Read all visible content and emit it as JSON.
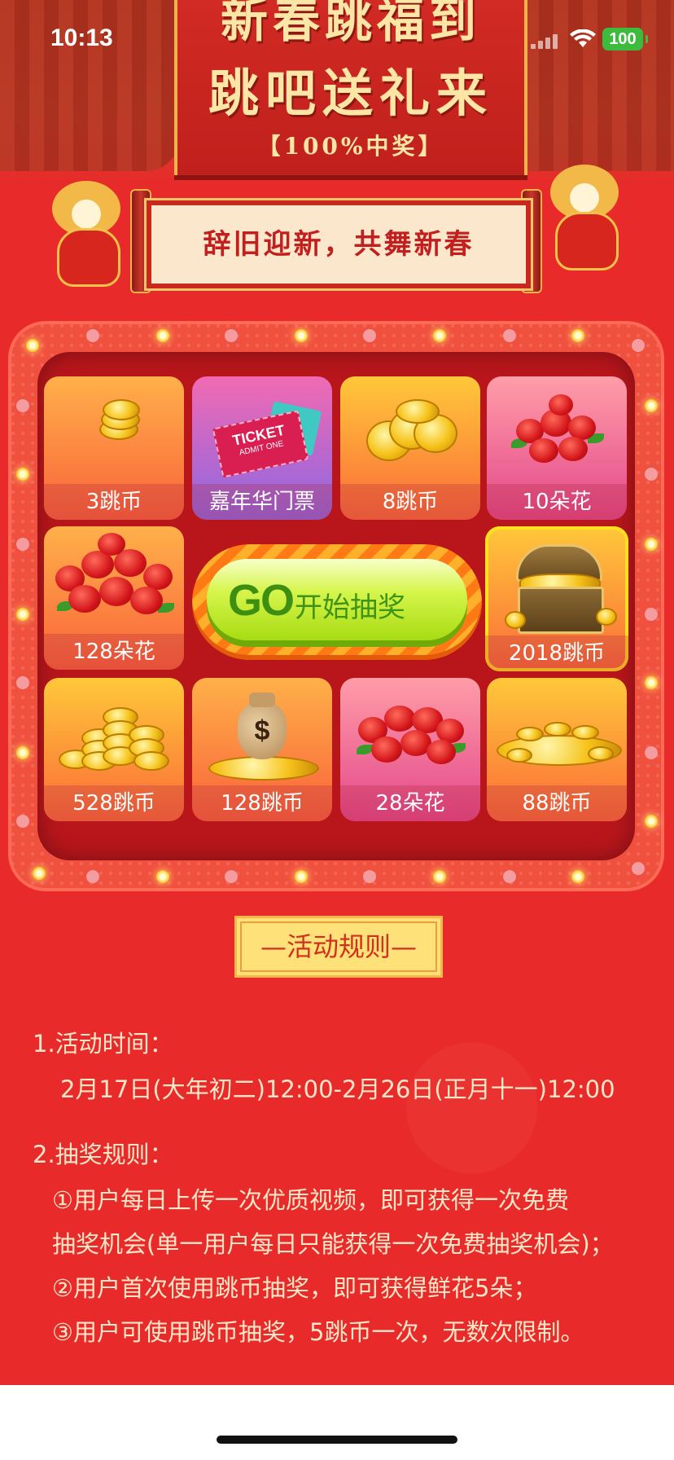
{
  "status_bar": {
    "time": "10:13",
    "battery": "100"
  },
  "header": {
    "title_line1": "新春跳福到",
    "title_line2": "跳吧送礼来",
    "subtitle": "【100%中奖】"
  },
  "slogan": "辞旧迎新，共舞新春",
  "prizes": [
    {
      "label": "3跳币",
      "icon": "coins-icon"
    },
    {
      "label": "嘉年华门票",
      "icon": "ticket-icon",
      "ticket_text": "TICKET",
      "ticket_sub": "ADMIT ONE"
    },
    {
      "label": "8跳币",
      "icon": "coins-icon"
    },
    {
      "label": "10朵花",
      "icon": "roses-icon"
    },
    {
      "label": "128朵花",
      "icon": "roses-icon"
    },
    {
      "label": "2018跳币",
      "icon": "treasure-chest-icon"
    },
    {
      "label": "528跳币",
      "icon": "coin-stacks-icon"
    },
    {
      "label": "128跳币",
      "icon": "money-bag-icon",
      "bag_symbol": "$"
    },
    {
      "label": "28朵花",
      "icon": "roses-icon"
    },
    {
      "label": "88跳币",
      "icon": "coin-pile-icon"
    }
  ],
  "go_button": {
    "go": "GO",
    "label": "开始抽奖"
  },
  "rules": {
    "title": "—活动规则—",
    "section1_title": "1.活动时间：",
    "section1_body": "2月17日(大年初二)12:00-2月26日(正月十一)12:00",
    "section2_title": "2.抽奖规则：",
    "rule_a_line1": "①用户每日上传一次优质视频，即可获得一次免费",
    "rule_a_line2": "抽奖机会(单一用户每日只能获得一次免费抽奖机会)；",
    "rule_b": "②用户首次使用跳币抽奖，即可获得鲜花5朵；",
    "rule_c": "③用户可使用跳币抽奖，5跳币一次，无数次限制。"
  }
}
